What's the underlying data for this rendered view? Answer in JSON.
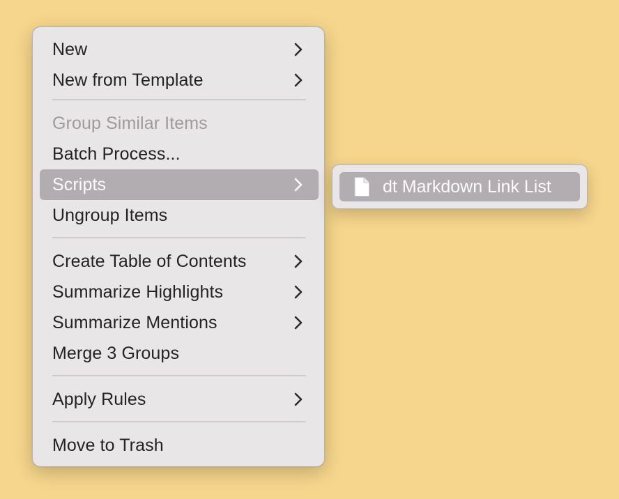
{
  "menu": {
    "items": [
      {
        "label": "New",
        "submenu": true
      },
      {
        "label": "New from Template",
        "submenu": true
      },
      {
        "label": "Group Similar Items",
        "disabled": true
      },
      {
        "label": "Batch Process..."
      },
      {
        "label": "Scripts",
        "submenu": true,
        "highlighted": true
      },
      {
        "label": "Ungroup Items"
      },
      {
        "label": "Create Table of Contents",
        "submenu": true
      },
      {
        "label": "Summarize Highlights",
        "submenu": true
      },
      {
        "label": "Summarize Mentions",
        "submenu": true
      },
      {
        "label": "Merge 3 Groups"
      },
      {
        "label": "Apply Rules",
        "submenu": true
      },
      {
        "label": "Move to Trash"
      }
    ]
  },
  "submenu": {
    "items": [
      {
        "label": "dt Markdown Link List",
        "icon": "document-icon",
        "highlighted": true
      }
    ]
  },
  "colors": {
    "desktop_background": "#f6d68c",
    "menu_background": "#e9e6e8",
    "highlight": "#b2adb1",
    "disabled_text": "#9f9a9d"
  }
}
